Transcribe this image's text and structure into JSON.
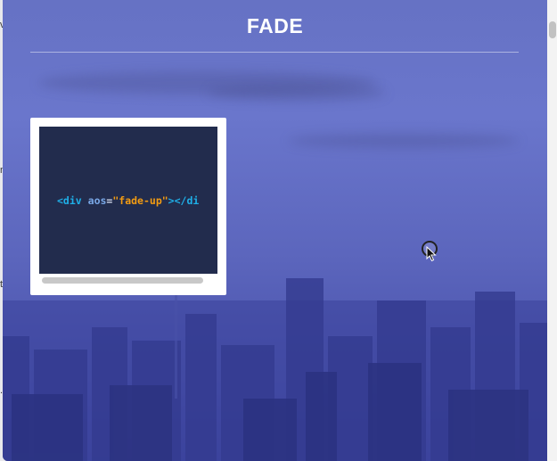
{
  "hero": {
    "title": "FADE"
  },
  "code_card": {
    "tokens": {
      "open_tag": "<div",
      "attr_name": "aos",
      "equals": "=",
      "attr_value": "\"fade-up\"",
      "close": "></di"
    }
  },
  "edge_fragments": [
    "v",
    "n",
    "t",
    "."
  ],
  "colors": {
    "hero_overlay": "#6672c4",
    "code_bg": "#222c4d",
    "tag": "#1fb0e8",
    "string": "#f39c12"
  }
}
